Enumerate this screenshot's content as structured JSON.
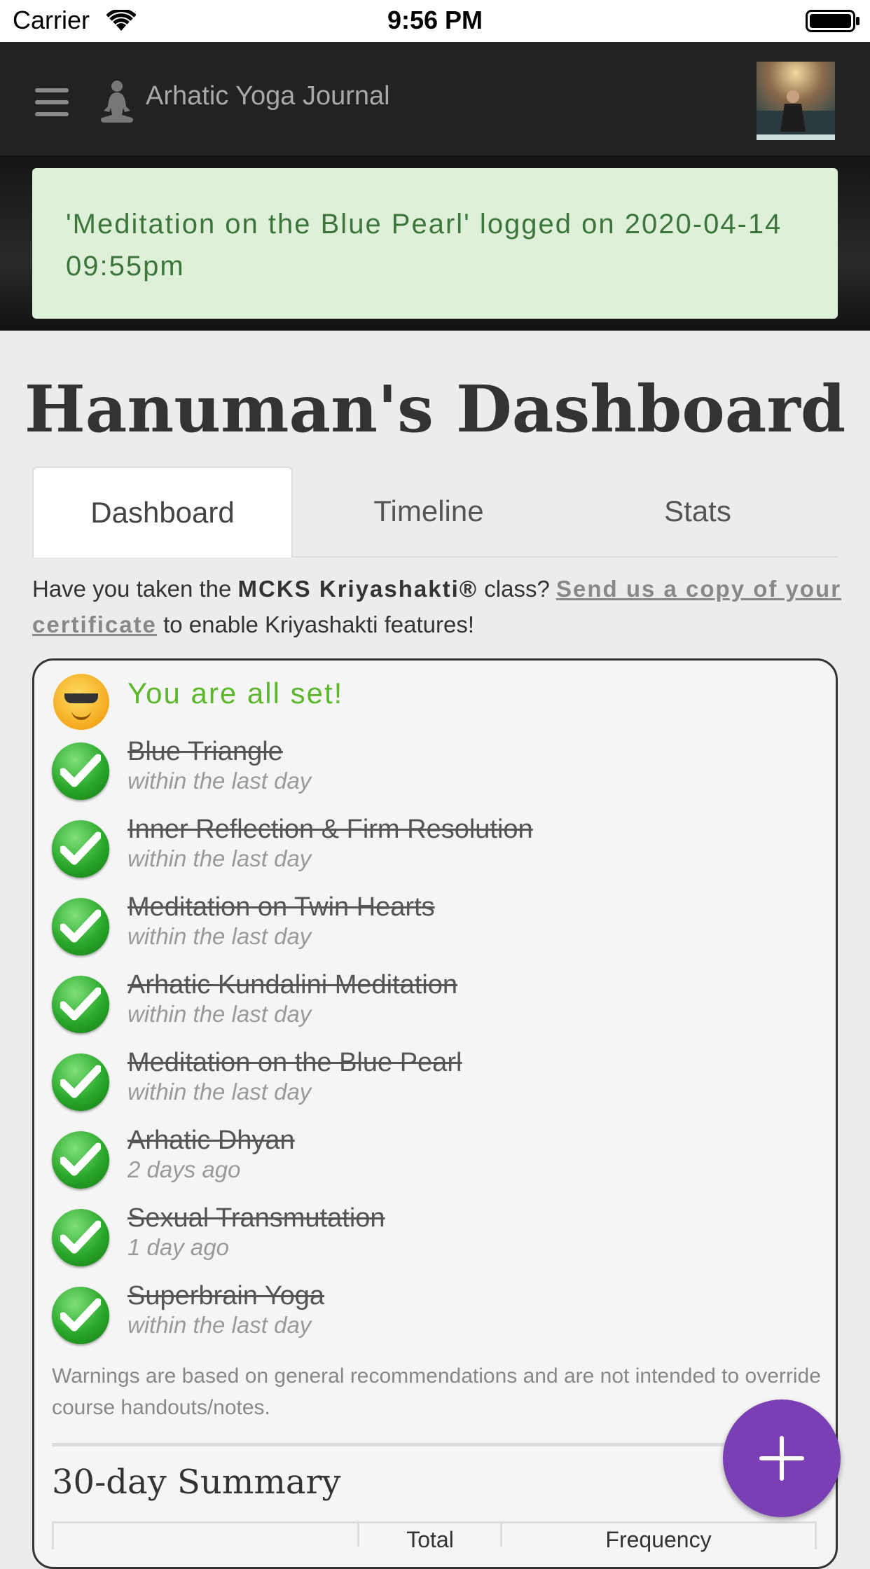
{
  "status_bar": {
    "carrier": "Carrier",
    "time": "9:56 PM"
  },
  "navbar": {
    "brand": "Arhatic Yoga Journal"
  },
  "alert": {
    "message": "'Meditation on the Blue Pearl' logged on 2020-04-14 09:55pm"
  },
  "page": {
    "title": "Hanuman's Dashboard"
  },
  "tabs": [
    {
      "label": "Dashboard",
      "active": true
    },
    {
      "label": "Timeline",
      "active": false
    },
    {
      "label": "Stats",
      "active": false
    }
  ],
  "kriyashakti": {
    "prefix": "Have you taken the ",
    "class_name": "MCKS Kriyashakti®",
    "middle": " class? ",
    "link": "Send us a copy of your certificate",
    "suffix": " to enable Kriyashakti features!"
  },
  "status_card": {
    "heading": "You are all set!",
    "items": [
      {
        "name": "Blue Triangle",
        "when": "within the last day"
      },
      {
        "name": "Inner Reflection & Firm Resolution",
        "when": "within the last day"
      },
      {
        "name": "Meditation on Twin Hearts",
        "when": "within the last day"
      },
      {
        "name": "Arhatic Kundalini Meditation",
        "when": "within the last day"
      },
      {
        "name": "Meditation on the Blue Pearl",
        "when": "within the last day"
      },
      {
        "name": "Arhatic Dhyan",
        "when": "2 days ago"
      },
      {
        "name": "Sexual Transmutation",
        "when": "1 day ago"
      },
      {
        "name": "Superbrain Yoga",
        "when": "within the last day"
      }
    ],
    "warning": "Warnings are based on general recommendations and are not intended to override course handouts/notes."
  },
  "summary": {
    "title": "30-day Summary",
    "columns": [
      "",
      "Total",
      "Frequency"
    ]
  },
  "colors": {
    "accent": "#7b3fb5",
    "success": "#5cb82b",
    "alert_bg": "#dff0d8",
    "alert_text": "#3c763d"
  }
}
